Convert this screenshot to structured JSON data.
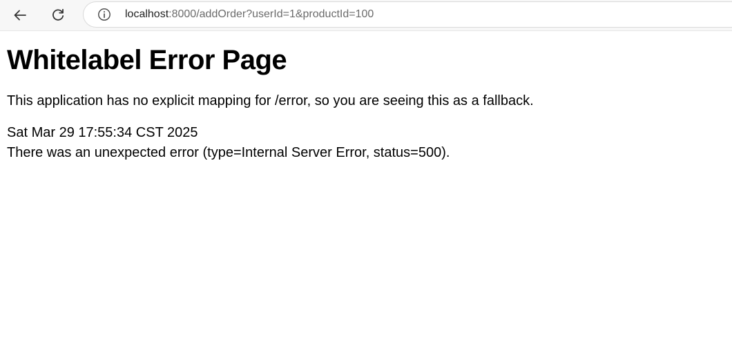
{
  "browser": {
    "url_host": "localhost",
    "url_rest": ":8000/addOrder?userId=1&productId=100"
  },
  "page": {
    "title": "Whitelabel Error Page",
    "message": "This application has no explicit mapping for /error, so you are seeing this as a fallback.",
    "timestamp": "Sat Mar 29 17:55:34 CST 2025",
    "error": "There was an unexpected error (type=Internal Server Error, status=500)."
  },
  "icons": {
    "back": "arrow-left-icon",
    "reload": "reload-icon",
    "info": "info-circle-icon"
  }
}
